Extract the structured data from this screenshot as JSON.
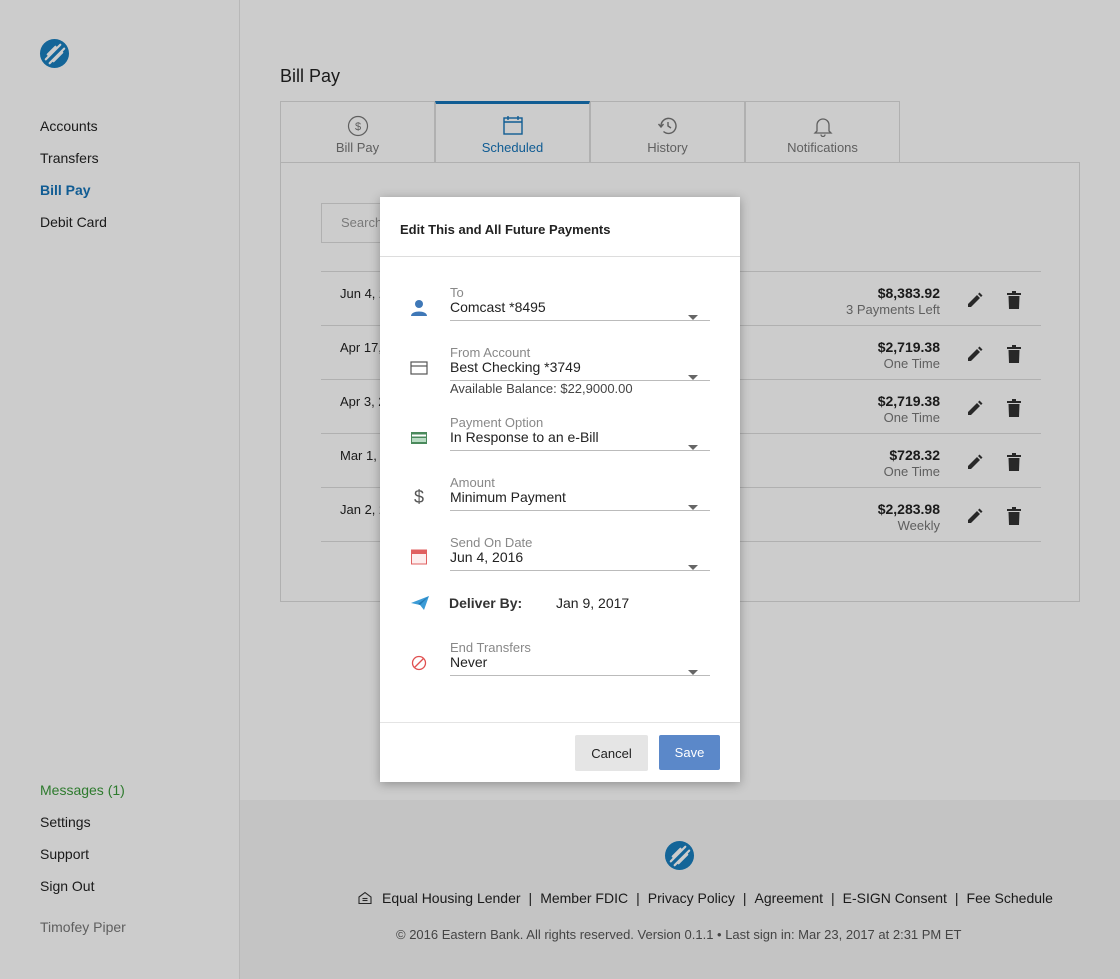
{
  "sidebar": {
    "nav": [
      "Accounts",
      "Transfers",
      "Bill Pay",
      "Debit Card"
    ],
    "messages": "Messages (1)",
    "bottom": [
      "Settings",
      "Support",
      "Sign Out"
    ],
    "user": "Timofey Piper"
  },
  "page": {
    "title": "Bill Pay",
    "tabs": [
      {
        "label": "Bill Pay",
        "icon": "dollar-circle-icon"
      },
      {
        "label": "Scheduled",
        "icon": "calendar-icon"
      },
      {
        "label": "History",
        "icon": "history-icon"
      },
      {
        "label": "Notifications",
        "icon": "bell-icon"
      }
    ],
    "active_tab": "Scheduled",
    "search_placeholder": "Search",
    "payments": [
      {
        "date": "Jun 4, 2",
        "amount": "$8,383.92",
        "sub": "3 Payments Left"
      },
      {
        "date": "Apr 17,",
        "amount": "$2,719.38",
        "sub": "One Time"
      },
      {
        "date": "Apr 3, 2",
        "amount": "$2,719.38",
        "sub": "One Time"
      },
      {
        "date": "Mar 1,",
        "amount": "$728.32",
        "sub": "One Time"
      },
      {
        "date": "Jan 2, 2",
        "amount": "$2,283.98",
        "sub": "Weekly"
      }
    ]
  },
  "modal": {
    "title": "Edit This and All Future Payments",
    "to_label": "To",
    "to_value": "Comcast *8495",
    "from_label": "From Account",
    "from_value": "Best Checking *3749",
    "balance": "Available Balance: $22,9000.00",
    "option_label": "Payment Option",
    "option_value": "In Response to an e-Bill",
    "amount_label": "Amount",
    "amount_value": "Minimum Payment",
    "date_label": "Send On Date",
    "date_value": "Jun 4, 2016",
    "deliver_label": "Deliver By:",
    "deliver_value": "Jan 9, 2017",
    "end_label": "End Transfers",
    "end_value": "Never",
    "cancel": "Cancel",
    "save": "Save"
  },
  "footer": {
    "links": [
      "Equal Housing Lender",
      "Member FDIC",
      "Privacy Policy",
      "Agreement",
      "E-SIGN Consent",
      "Fee Schedule"
    ],
    "separator": "|",
    "copyright": "© 2016 Eastern Bank. All rights reserved. Version 0.1.1 • Last sign in: Mar 23, 2017 at 2:31 PM ET"
  },
  "colors": {
    "accent": "#1473b8",
    "messages": "#3a9a3a",
    "save": "#5b88c9"
  }
}
